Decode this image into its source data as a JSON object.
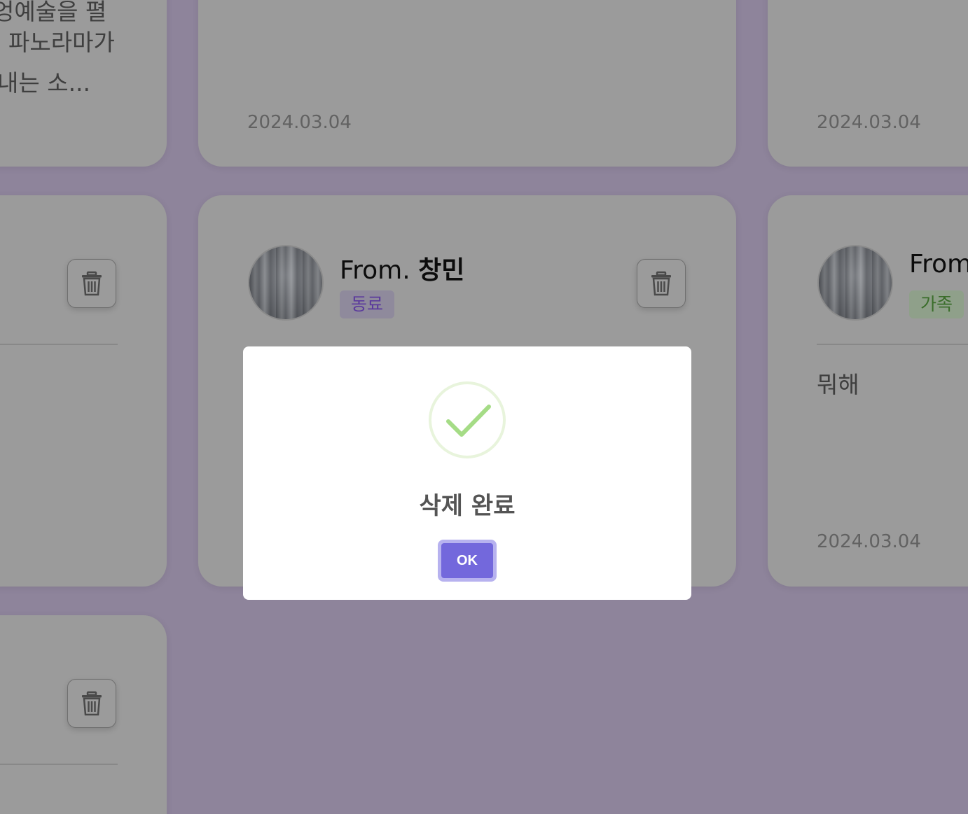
{
  "cards": {
    "top_left": {
      "lines": [
        "엉예술을 펼",
        "파노라마가",
        "내는 소..."
      ]
    },
    "top_middle": {
      "date": "2024.03.04"
    },
    "top_right": {
      "date": "2024.03.04"
    },
    "middle_middle": {
      "from_prefix": "From.",
      "from_name": "창민",
      "badge": "동료"
    },
    "middle_right": {
      "from_prefix": "From",
      "badge": "가족",
      "message": "뭐해",
      "date": "2024.03.04"
    }
  },
  "modal": {
    "icon": "success-check-icon",
    "title": "삭제 완료",
    "ok_label": "OK"
  },
  "colors": {
    "overlay_bg": "#8e849b",
    "ok_button": "#7368dc",
    "check": "#a5dc86"
  }
}
